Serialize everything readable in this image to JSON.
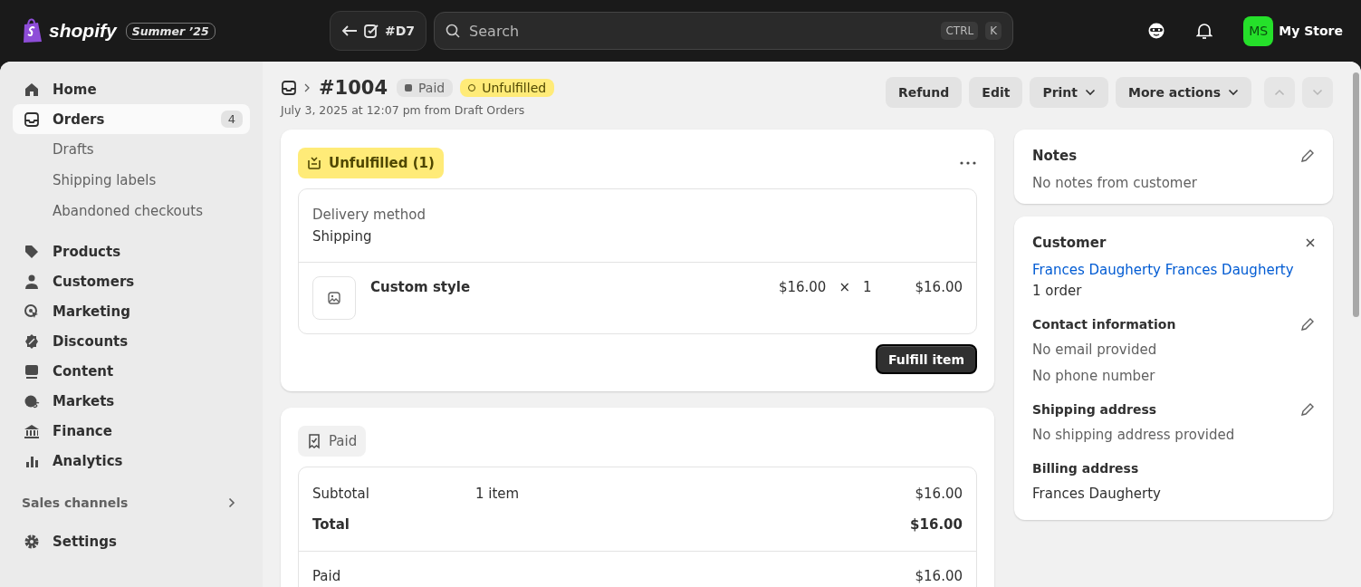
{
  "topbar": {
    "brand": "shopify",
    "edition": "Summer ’25",
    "back_ref": "#D7",
    "search": {
      "placeholder": "Search",
      "keys": [
        "CTRL",
        "K"
      ]
    },
    "avatar": "MS",
    "store": "My Store"
  },
  "sidebar": {
    "items": [
      {
        "label": "Home",
        "selected": false
      },
      {
        "label": "Orders",
        "selected": true,
        "count": "4",
        "children": [
          {
            "label": "Drafts"
          },
          {
            "label": "Shipping labels"
          },
          {
            "label": "Abandoned checkouts"
          }
        ]
      },
      {
        "label": "Products",
        "selected": false
      },
      {
        "label": "Customers",
        "selected": false
      },
      {
        "label": "Marketing",
        "selected": false
      },
      {
        "label": "Discounts",
        "selected": false
      },
      {
        "label": "Content",
        "selected": false
      },
      {
        "label": "Markets",
        "selected": false
      },
      {
        "label": "Finance",
        "selected": false
      },
      {
        "label": "Analytics",
        "selected": false
      }
    ],
    "section": "Sales channels",
    "settings": "Settings"
  },
  "header": {
    "title": "#1004",
    "badges": [
      {
        "label": "Paid",
        "kind": "neutral"
      },
      {
        "label": "Unfulfilled",
        "kind": "warning"
      }
    ],
    "subtitle": "July 3, 2025 at 12:07 pm from Draft Orders",
    "actions": [
      {
        "label": "Refund",
        "dropdown": false
      },
      {
        "label": "Edit",
        "dropdown": false
      },
      {
        "label": "Print",
        "dropdown": true
      },
      {
        "label": "More actions",
        "dropdown": true
      }
    ]
  },
  "fulfillment": {
    "badge": "Unfulfilled (1)",
    "method_label": "Delivery method",
    "method": "Shipping",
    "item": {
      "name": "Custom style",
      "price": "$16.00",
      "times": "×",
      "qty": "1",
      "total": "$16.00"
    },
    "button": "Fulfill item"
  },
  "payment": {
    "badge": "Paid",
    "rows": [
      {
        "label": "Subtotal",
        "detail": "1 item",
        "amount": "$16.00",
        "bold": false
      },
      {
        "label": "Total",
        "amount": "$16.00",
        "bold": true
      }
    ],
    "paid": {
      "label": "Paid",
      "amount": "$16.00"
    }
  },
  "notes": {
    "title": "Notes",
    "text": "No notes from customer"
  },
  "customer": {
    "title": "Customer",
    "name": "Frances Daugherty Frances Daugherty",
    "orders": "1 order",
    "sections": [
      {
        "title": "Contact information",
        "editable": true,
        "lines": [
          "No email provided",
          "No phone number"
        ]
      },
      {
        "title": "Shipping address",
        "editable": true,
        "lines": [
          "No shipping address provided"
        ]
      },
      {
        "title": "Billing address",
        "editable": false,
        "lines": [
          "Frances Daugherty"
        ]
      }
    ]
  }
}
